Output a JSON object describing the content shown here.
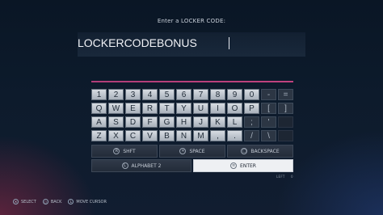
{
  "prompt": "Enter a LOCKER CODE:",
  "code_value": "LOCKERCODEBONUS",
  "keyboard": {
    "row1": [
      "1",
      "2",
      "3",
      "4",
      "5",
      "6",
      "7",
      "8",
      "9",
      "0",
      "-",
      "="
    ],
    "row2": [
      "Q",
      "W",
      "E",
      "R",
      "T",
      "Y",
      "U",
      "I",
      "O",
      "P",
      "[",
      "]"
    ],
    "row3": [
      "A",
      "S",
      "D",
      "F",
      "G",
      "H",
      "J",
      "K",
      "L",
      ";",
      "'",
      ""
    ],
    "row4": [
      "Z",
      "X",
      "C",
      "V",
      "B",
      "N",
      "M",
      ",",
      ".",
      "/",
      "\\",
      ""
    ]
  },
  "actions": {
    "shift": "SHFT",
    "space": "SPACE",
    "backspace": "BACKSPACE",
    "alphabet": "ALPHABET 2",
    "enter": "ENTER"
  },
  "left": {
    "label": "LEFT",
    "count": "0"
  },
  "footer": {
    "select": "SELECT",
    "back": "BACK",
    "move_cursor": "MOVE CURSOR"
  },
  "icons": {
    "shift": "r1-icon",
    "space": "cross-icon",
    "backspace": "square-icon",
    "alphabet": "l2-icon",
    "enter": "options-icon",
    "select": "cross-icon",
    "back": "circle-icon",
    "move_cursor": "left-stick-icon"
  },
  "colors": {
    "accent": "#c0427e",
    "key_light": "#d7dce2",
    "key_dark": "#2c3644",
    "enter_bg": "#eef0f3"
  }
}
